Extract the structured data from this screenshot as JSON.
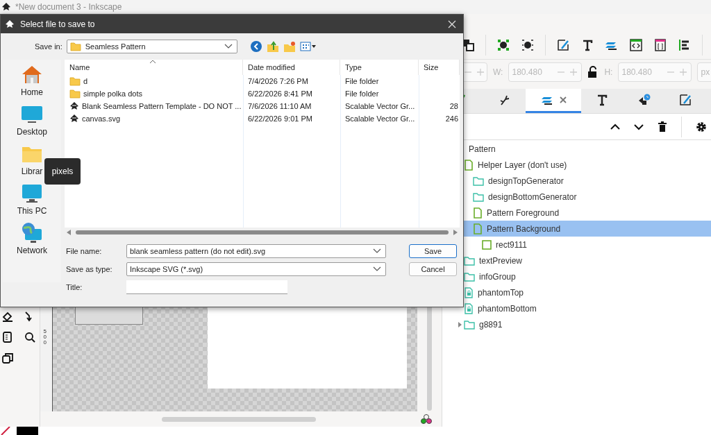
{
  "app_window": {
    "title": "*New document 3 - Inkscape"
  },
  "dimensions": {
    "disabled": true,
    "fields": [
      {
        "label": "W:",
        "value": "180.480"
      },
      {
        "label": "H:",
        "value": "180.480"
      }
    ],
    "unit": "px"
  },
  "panel": {
    "tabs": [
      {
        "selected": false
      },
      {
        "selected": false
      },
      {
        "selected": true
      },
      {
        "selected": false
      },
      {
        "selected": false
      },
      {
        "selected": false
      }
    ],
    "layers": [
      {
        "name": "Pattern",
        "kind": "layer",
        "selected": false,
        "children": [
          {
            "name": "Helper Layer (don't use)",
            "kind": "layer",
            "selected": false,
            "children": [
              {
                "name": "designTopGenerator",
                "kind": "group",
                "selected": false
              },
              {
                "name": "designBottomGenerator",
                "kind": "group",
                "selected": false
              },
              {
                "name": "Pattern Foreground",
                "kind": "layer",
                "selected": false
              },
              {
                "name": "Pattern Background",
                "kind": "layer",
                "selected": true,
                "children": [
                  {
                    "name": "rect9111",
                    "kind": "rect",
                    "selected": false
                  }
                ]
              }
            ]
          },
          {
            "name": "textPreview",
            "kind": "group",
            "selected": false
          },
          {
            "name": "infoGroup",
            "kind": "group",
            "selected": false
          },
          {
            "name": "phantomTop",
            "kind": "locked",
            "selected": false
          },
          {
            "name": "phantomBottom",
            "kind": "locked",
            "selected": false
          },
          {
            "name": "g8891",
            "kind": "group",
            "selected": false,
            "expanded": false
          }
        ]
      }
    ]
  },
  "canvas": {
    "ruler_label": "500"
  },
  "tooltip": "pixels",
  "dialog": {
    "title": "Select file to save to",
    "save_in_label": "Save in:",
    "save_in": "Seamless Pattern",
    "places": [
      {
        "label": "Home"
      },
      {
        "label": "Desktop"
      },
      {
        "label": "Librar"
      },
      {
        "label": "This PC"
      },
      {
        "label": "Network"
      }
    ],
    "columns": [
      "Name",
      "Date modified",
      "Type",
      "Size"
    ],
    "files": [
      {
        "kind": "folder",
        "name": "d",
        "date": "7/4/2026 7:26 PM",
        "type": "File folder"
      },
      {
        "kind": "folder",
        "name": "simple polka dots",
        "date": "6/22/2026 8:41 PM",
        "type": "File folder"
      },
      {
        "kind": "svg",
        "name": "Blank Seamless Pattern Template - DO NOT ...",
        "date": "7/6/2026 11:10 AM",
        "type": "Scalable Vector Gr...",
        "size": "28"
      },
      {
        "kind": "svg",
        "name": "canvas.svg",
        "date": "6/22/2026 9:01 PM",
        "type": "Scalable Vector Gr...",
        "size": "246"
      }
    ],
    "file_name_label": "File name:",
    "file_name": "blank seamless pattern (do not edit).svg",
    "type_label": "Save as type:",
    "file_type": "Inkscape SVG (*.svg)",
    "title_label": "Title:",
    "buttons": [
      "Save",
      "Cancel"
    ]
  }
}
